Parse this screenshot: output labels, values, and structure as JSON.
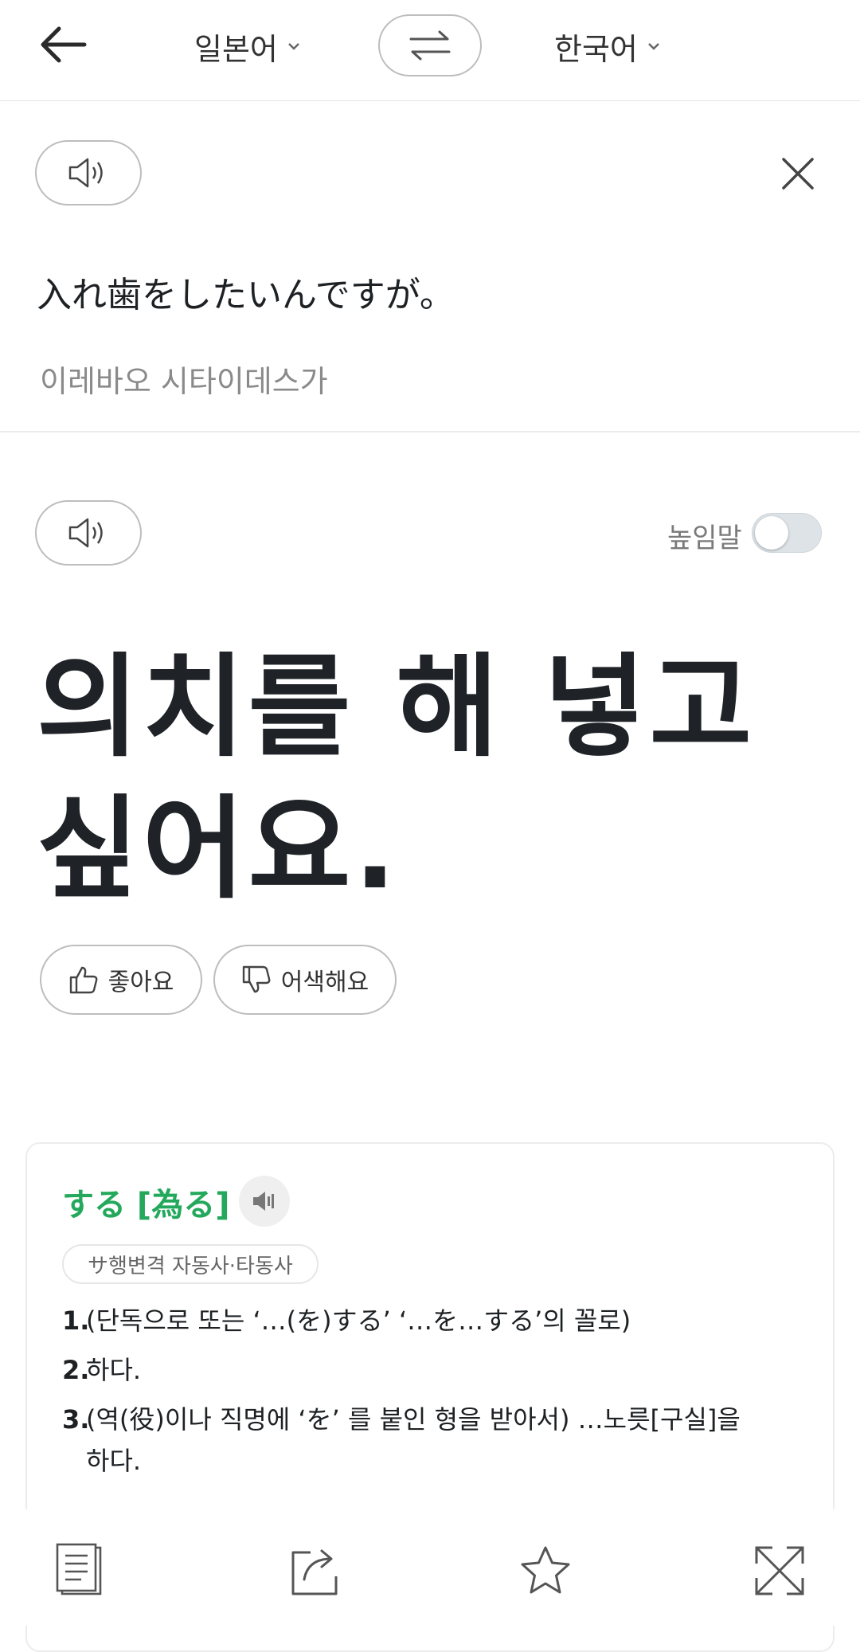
{
  "header": {
    "source_lang": "일본어",
    "target_lang": "한국어"
  },
  "source": {
    "text": "入れ歯をしたいんですが。",
    "reading": "이레바오 시타이데스가"
  },
  "result": {
    "honorific_label": "높임말",
    "honorific_on": false,
    "translation": "의치를 해 넣고 싶어요.",
    "like_label": "좋아요",
    "dislike_label": "어색해요"
  },
  "dictionary": {
    "word": "する [為る]",
    "part_of_speech": "サ행변격 자동사·타동사",
    "definitions": [
      {
        "num": "1.",
        "text": "(단독으로 또는 ‘…(を)する’ ‘…を…する’의 꼴로)"
      },
      {
        "num": "2.",
        "text": "하다."
      },
      {
        "num": "3.",
        "text": "(역(役)이나 직명에 ‘を’ 를 붙인 형을 받아서) …노릇[구실]을 하다."
      }
    ]
  },
  "colors": {
    "accent_green": "#24a95c",
    "text_dark": "#1e2124",
    "text_gray": "#8a8a8a",
    "border": "#bdbdbd"
  },
  "icons": {
    "back": "arrow-left-icon",
    "swap": "swap-arrows-icon",
    "speaker": "speaker-icon",
    "close": "close-icon",
    "like": "thumbs-up-icon",
    "dislike": "thumbs-down-icon",
    "copy": "copy-icon",
    "share": "share-icon",
    "favorite": "star-icon",
    "fullscreen": "expand-icon"
  }
}
